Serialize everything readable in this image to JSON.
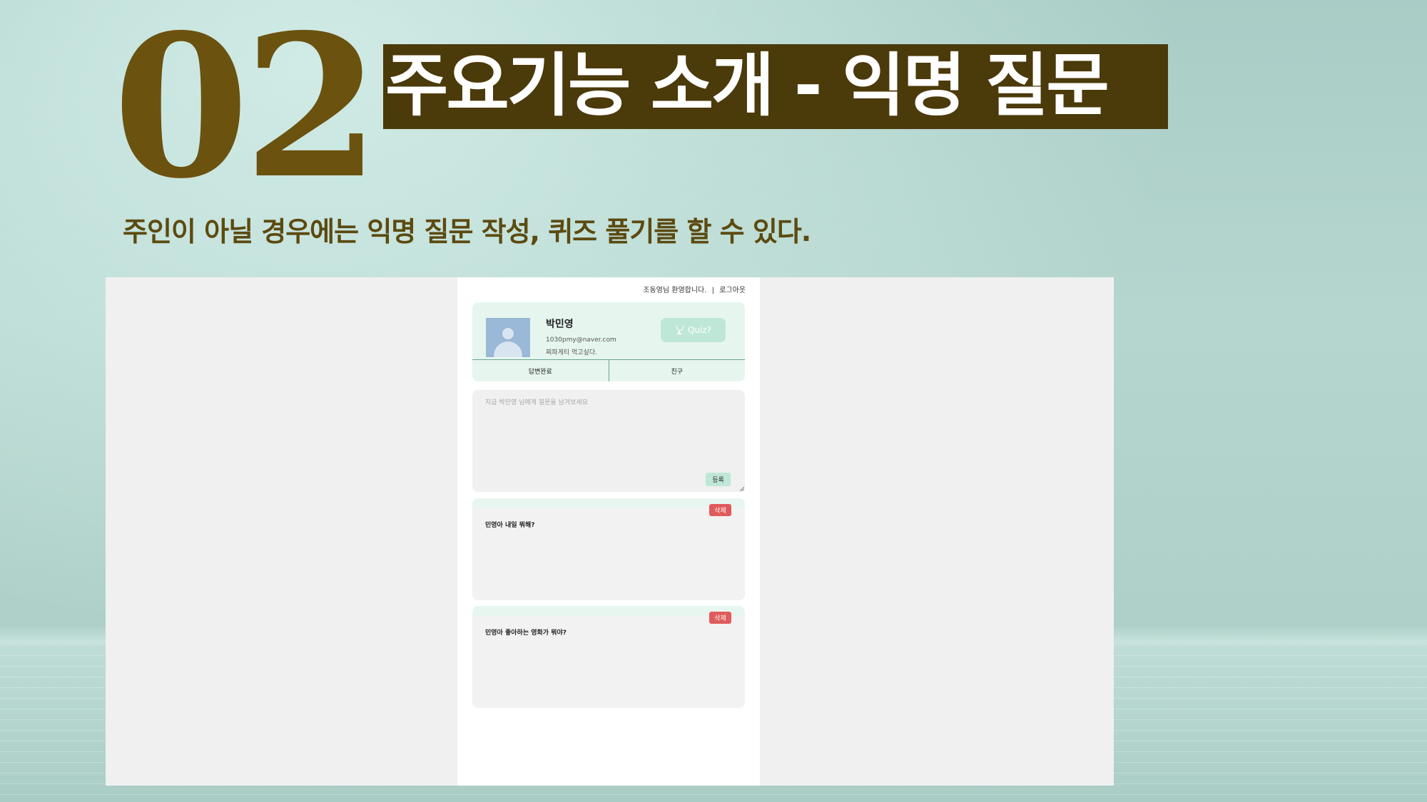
{
  "slide": {
    "number": "02",
    "title": "주요기능 소개 - 익명 질문",
    "subtitle": "주인이 아닐 경우에는 익명 질문 작성, 퀴즈 풀기를 할 수 있다."
  },
  "header": {
    "welcome": "조동영님 환영합니다.",
    "separator": "|",
    "logout_label": "로그아웃"
  },
  "profile": {
    "name": "박민영",
    "email": "1030pmy@naver.com",
    "bio": "찌파게티 먹고싶다.",
    "avatar_icon": "user-avatar-icon",
    "quiz_label": "Quiz?",
    "quiz_icon": "trophy-icon"
  },
  "tabs": [
    {
      "label": "답변완료"
    },
    {
      "label": "친구"
    }
  ],
  "ask": {
    "placeholder": "지금 박민영 님에게 질문을 남겨보세요",
    "submit_label": "등록"
  },
  "questions": [
    {
      "text": "민영아 내일 뭐해?",
      "delete_label": "삭제"
    },
    {
      "text": "민영아 좋아하는 영화가 뭐야?",
      "delete_label": "삭제"
    }
  ],
  "colors": {
    "accent_mint": "#bfe7d7",
    "card_mint": "#e6f6ef",
    "delete_red": "#e05b5b",
    "title_bg": "#4b3a0a",
    "number_gold": "#6b520f"
  }
}
